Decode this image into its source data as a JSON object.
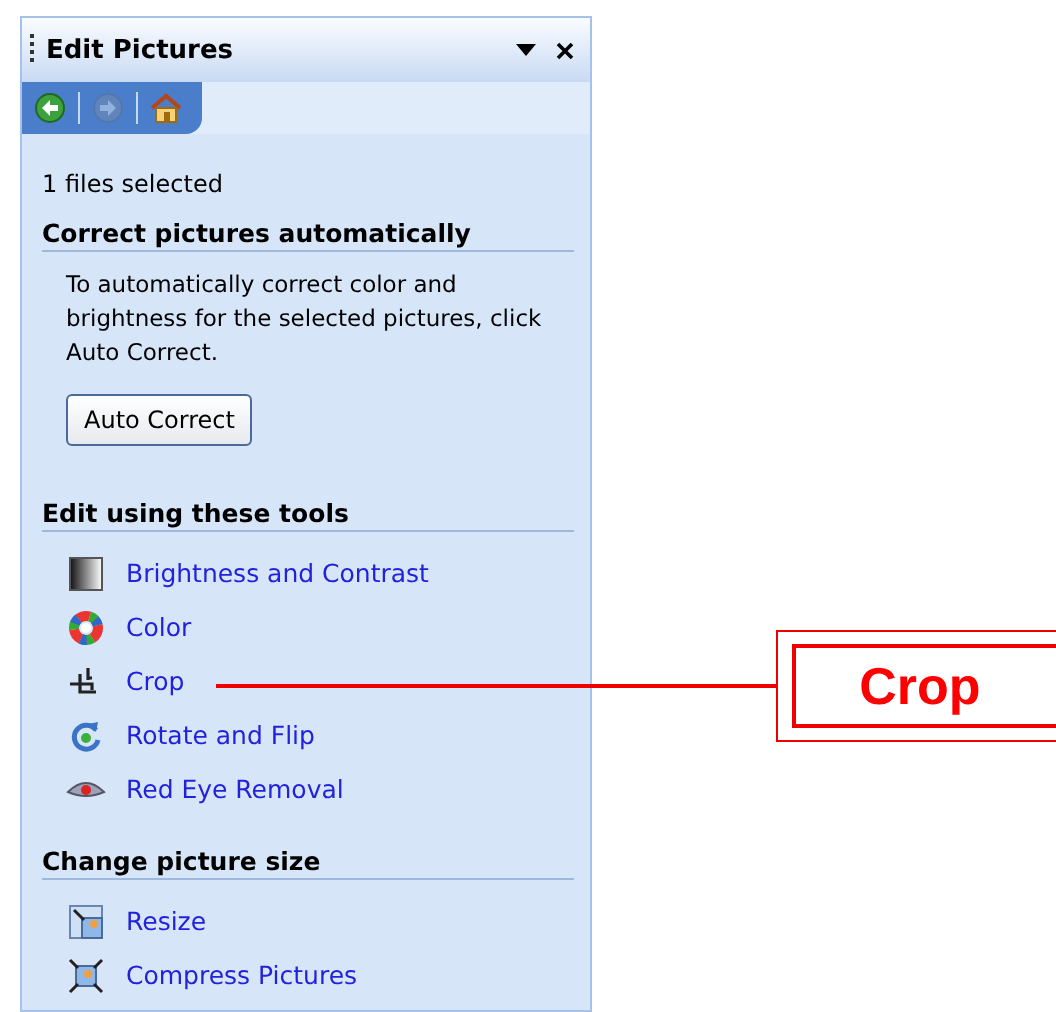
{
  "pane": {
    "title": "Edit Pictures",
    "nav": [
      {
        "kind": "back",
        "disabled": false
      },
      {
        "kind": "forward",
        "disabled": true
      },
      {
        "kind": "home",
        "disabled": false
      }
    ],
    "status": "1 files selected",
    "sections": [
      {
        "heading": "Correct pictures automatically",
        "text": "To automatically correct color and brightness for the selected pictures, click Auto Correct.",
        "button": "Auto Correct"
      },
      {
        "heading": "Edit using these tools",
        "links": [
          {
            "kind": "brightness",
            "label": "Brightness and Contrast"
          },
          {
            "kind": "color",
            "label": "Color"
          },
          {
            "kind": "crop",
            "label": "Crop"
          },
          {
            "kind": "rotate",
            "label": "Rotate and Flip"
          },
          {
            "kind": "redeye",
            "label": "Red Eye Removal"
          }
        ]
      },
      {
        "heading": "Change picture size",
        "links": [
          {
            "kind": "resize",
            "label": "Resize"
          },
          {
            "kind": "compress",
            "label": "Compress Pictures"
          }
        ]
      }
    ]
  },
  "callout": {
    "label": "Crop"
  }
}
